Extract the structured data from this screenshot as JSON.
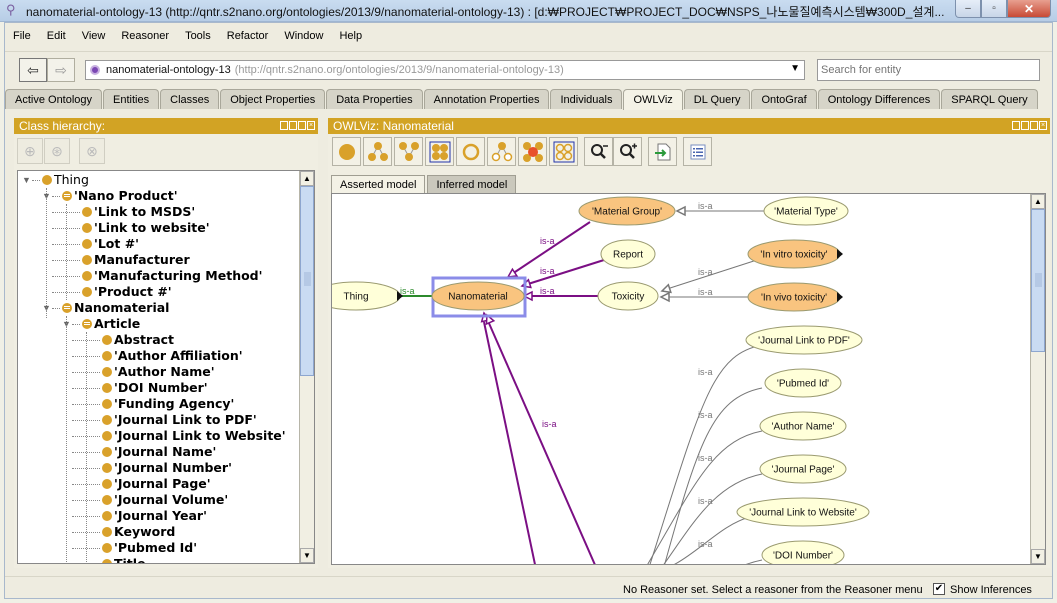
{
  "window": {
    "title": "nanomaterial-ontology-13 (http://qntr.s2nano.org/ontologies/2013/9/nanomaterial-ontology-13)  : [d:₩PROJECT₩PROJECT_DOC₩NSPS_나노물질예측시스템₩300D_설계...",
    "minimize": "–",
    "maximize": "▫",
    "close": "✕"
  },
  "menu": [
    "File",
    "Edit",
    "View",
    "Reasoner",
    "Tools",
    "Refactor",
    "Window",
    "Help"
  ],
  "nav": {
    "back_icon": "⇦",
    "forward_icon": "⇨",
    "ontology_name": "nanomaterial-ontology-13",
    "ontology_uri": "(http://qntr.s2nano.org/ontologies/2013/9/nanomaterial-ontology-13)",
    "dropdown_arrow": "▼",
    "search_placeholder": "Search for entity"
  },
  "tabs": [
    {
      "label": "Active Ontology"
    },
    {
      "label": "Entities"
    },
    {
      "label": "Classes"
    },
    {
      "label": "Object Properties"
    },
    {
      "label": "Data Properties"
    },
    {
      "label": "Annotation Properties"
    },
    {
      "label": "Individuals"
    },
    {
      "label": "OWLViz",
      "active": true
    },
    {
      "label": "DL Query"
    },
    {
      "label": "OntoGraf"
    },
    {
      "label": "Ontology Differences"
    },
    {
      "label": "SPARQL Query"
    }
  ],
  "class_hierarchy": {
    "title": "Class hierarchy:",
    "items": [
      {
        "label": "Thing",
        "level": 0,
        "expanded": true,
        "defined": false,
        "bold": false
      },
      {
        "label": "'Nano Product'",
        "level": 1,
        "expanded": true,
        "defined": true,
        "bold": true
      },
      {
        "label": "'Link to MSDS'",
        "level": 2,
        "bold": true
      },
      {
        "label": "'Link to website'",
        "level": 2,
        "bold": true
      },
      {
        "label": "'Lot #'",
        "level": 2,
        "bold": true
      },
      {
        "label": "Manufacturer",
        "level": 2,
        "bold": true
      },
      {
        "label": "'Manufacturing Method'",
        "level": 2,
        "bold": true
      },
      {
        "label": "'Product #'",
        "level": 2,
        "bold": true
      },
      {
        "label": "Nanomaterial",
        "level": 1,
        "expanded": true,
        "defined": true,
        "bold": true
      },
      {
        "label": "Article",
        "level": 2,
        "expanded": true,
        "defined": true,
        "bold": true
      },
      {
        "label": "Abstract",
        "level": 3,
        "bold": true
      },
      {
        "label": "'Author Affiliation'",
        "level": 3,
        "bold": true
      },
      {
        "label": "'Author Name'",
        "level": 3,
        "bold": true
      },
      {
        "label": "'DOI Number'",
        "level": 3,
        "bold": true
      },
      {
        "label": "'Funding Agency'",
        "level": 3,
        "bold": true
      },
      {
        "label": "'Journal Link to PDF'",
        "level": 3,
        "bold": true
      },
      {
        "label": "'Journal Link to Website'",
        "level": 3,
        "bold": true
      },
      {
        "label": "'Journal Name'",
        "level": 3,
        "bold": true
      },
      {
        "label": "'Journal Number'",
        "level": 3,
        "bold": true
      },
      {
        "label": "'Journal Page'",
        "level": 3,
        "bold": true
      },
      {
        "label": "'Journal Volume'",
        "level": 3,
        "bold": true
      },
      {
        "label": "'Journal Year'",
        "level": 3,
        "bold": true
      },
      {
        "label": "Keyword",
        "level": 3,
        "bold": true
      },
      {
        "label": "'Pubmed Id'",
        "level": 3,
        "bold": true
      },
      {
        "label": "Title",
        "level": 3,
        "bold": true
      }
    ]
  },
  "owlviz": {
    "title": "OWLViz: Nanomaterial",
    "toolbar": [
      "show-class-icon",
      "show-subclasses-icon",
      "show-superclasses-icon",
      "show-all-classes-icon",
      "hide-class-icon",
      "hide-subclasses-icon",
      "hide-all-classes-icon",
      "show-classes-grid-icon",
      "zoom-out-icon",
      "zoom-in-icon",
      "export-icon",
      "options-icon"
    ],
    "subtabs": [
      {
        "label": "Asserted model",
        "active": true
      },
      {
        "label": "Inferred model"
      }
    ],
    "edge_label": "is-a",
    "nodes": [
      {
        "id": "thing",
        "label": "Thing",
        "style": "plain",
        "more": true
      },
      {
        "id": "nano",
        "label": "Nanomaterial",
        "style": "defined",
        "selected": true
      },
      {
        "id": "mgroup",
        "label": "'Material Group'",
        "style": "defined"
      },
      {
        "id": "mtype",
        "label": "'Material Type'",
        "style": "plain"
      },
      {
        "id": "report",
        "label": "Report",
        "style": "plain"
      },
      {
        "id": "tox",
        "label": "Toxicity",
        "style": "plain"
      },
      {
        "id": "vitro",
        "label": "'In vitro toxicity'",
        "style": "defined",
        "more": true
      },
      {
        "id": "vivo",
        "label": "'In vivo toxicity'",
        "style": "defined",
        "more": true
      },
      {
        "id": "jpdf",
        "label": "'Journal Link to PDF'",
        "style": "plain"
      },
      {
        "id": "pubmed",
        "label": "'Pubmed Id'",
        "style": "plain"
      },
      {
        "id": "aname",
        "label": "'Author Name'",
        "style": "plain"
      },
      {
        "id": "jpage",
        "label": "'Journal Page'",
        "style": "plain"
      },
      {
        "id": "jweb",
        "label": "'Journal Link to Website'",
        "style": "plain"
      },
      {
        "id": "doi",
        "label": "'DOI Number'",
        "style": "plain"
      }
    ]
  },
  "status": {
    "message": "No Reasoner set. Select a reasoner from the Reasoner menu",
    "show_inferences_label": "Show Inferences",
    "show_inferences_checked": true,
    "check_glyph": "✔"
  },
  "colors": {
    "panel_header": "#d2a324",
    "class_dot": "#d9a12a",
    "node_defined": "#f9c47f",
    "node_plain": "#ffffd9",
    "edge_purple": "#7b0f84",
    "edge_green": "#2c8a2c",
    "edge_gray": "#777777",
    "selection_box": "#8b8ce8"
  }
}
